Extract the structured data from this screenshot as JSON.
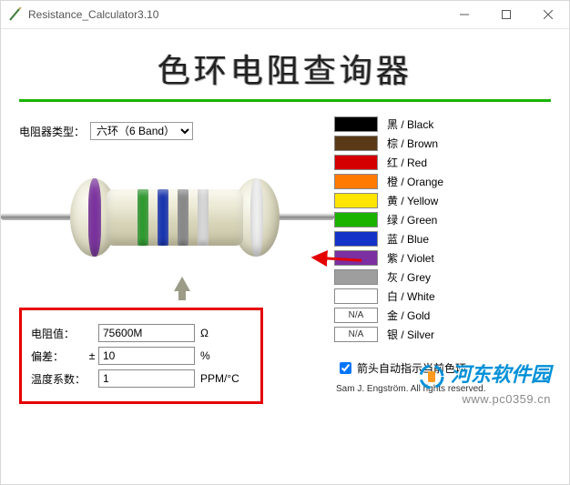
{
  "window": {
    "title": "Resistance_Calculator3.10"
  },
  "heading": "色环电阻查询器",
  "type_row": {
    "label": "电阻器类型：",
    "value": "六环（6 Band）"
  },
  "bands": [
    {
      "color": "#7b2fa0",
      "pos": 20,
      "cap": true
    },
    {
      "color": "#2e9b2e",
      "pos": 74
    },
    {
      "color": "#1835b0",
      "pos": 96
    },
    {
      "color": "#8a8a8a",
      "pos": 118
    },
    {
      "color": "#d8d8d8",
      "pos": 140
    },
    {
      "color": "#f2f2f2",
      "pos": 198,
      "cap": true
    }
  ],
  "readout": {
    "value_label": "电阻值：",
    "value": "75600M",
    "value_unit": "Ω",
    "tol_label": "偏差：",
    "tol_pm": "±",
    "tol": "10",
    "tol_unit": "%",
    "tc_label": "温度系数：",
    "tc": "1",
    "tc_unit": "PPM/°C"
  },
  "legend": [
    {
      "hex": "#000000",
      "label": "黑  / Black"
    },
    {
      "hex": "#5a3a16",
      "label": "棕  / Brown"
    },
    {
      "hex": "#d40000",
      "label": "红  / Red"
    },
    {
      "hex": "#ff7a00",
      "label": "橙  / Orange"
    },
    {
      "hex": "#ffe500",
      "label": "黄  / Yellow"
    },
    {
      "hex": "#19b300",
      "label": "绿  / Green"
    },
    {
      "hex": "#1431c8",
      "label": "蓝  / Blue"
    },
    {
      "hex": "#7b2fa0",
      "label": "紫  / Violet"
    },
    {
      "hex": "#9e9e9e",
      "label": "灰  / Grey"
    },
    {
      "hex": "#ffffff",
      "label": "白  / White"
    },
    {
      "na": true,
      "label": "金  / Gold",
      "na_text": "N/A"
    },
    {
      "na": true,
      "label": "银  / Silver",
      "na_text": "N/A"
    }
  ],
  "auto_arrow": {
    "checked": true,
    "label": "箭头自动指示当前色环"
  },
  "credit": "Sam J. Engström.  All rights reserved.",
  "watermark": {
    "line1": "河东软件园",
    "line2": "www.pc0359.cn"
  }
}
